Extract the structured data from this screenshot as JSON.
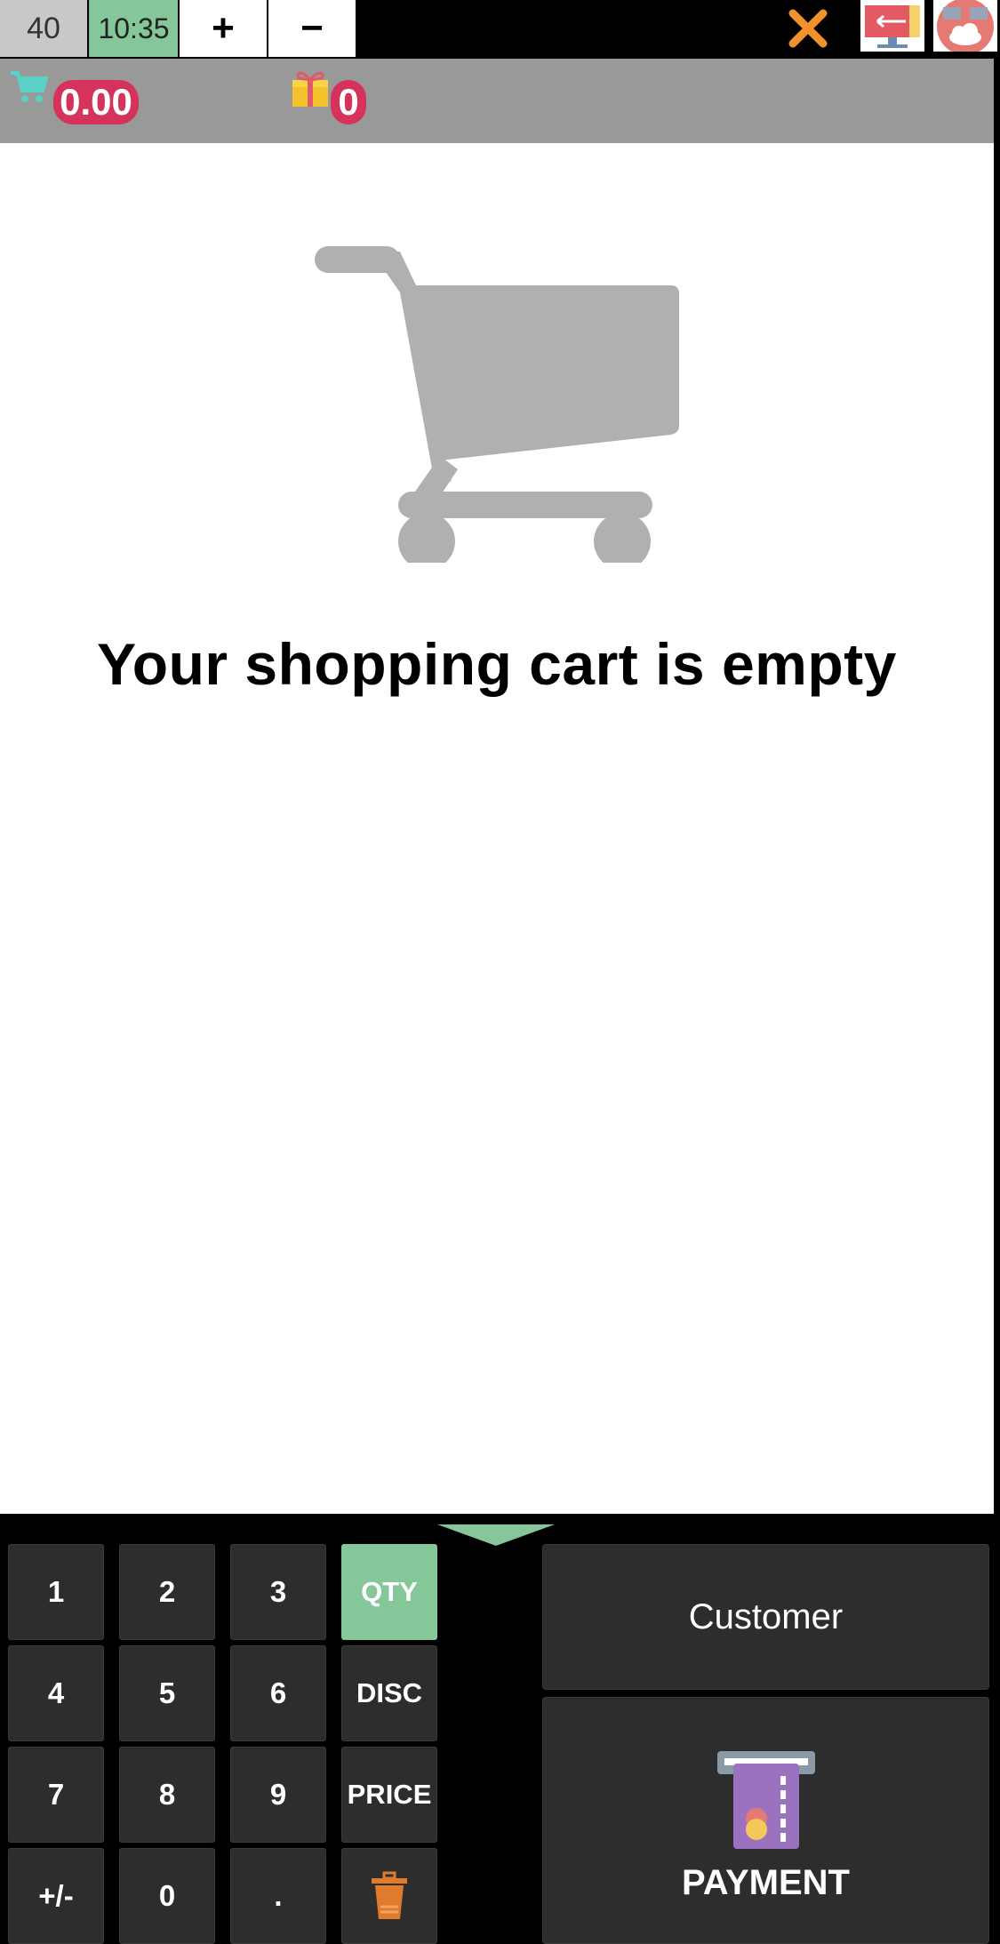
{
  "topbar": {
    "table_number": "40",
    "time": "10:35",
    "plus_label": "+",
    "minus_label": "−",
    "close_icon": "close-icon",
    "screen_icon": "swap-screen-icon",
    "cloud_icon": "cloud-sync-icon"
  },
  "summary": {
    "cart_total": "0.00",
    "gift_count": "0"
  },
  "main": {
    "empty_message": "Your shopping cart is empty",
    "empty_icon": "shopping-cart-icon"
  },
  "keypad": {
    "digits": {
      "k1": "1",
      "k2": "2",
      "k3": "3",
      "k4": "4",
      "k5": "5",
      "k6": "6",
      "k7": "7",
      "k8": "8",
      "k9": "9",
      "sign": "+/-",
      "k0": "0",
      "dot": "."
    },
    "modes": {
      "qty": "QTY",
      "disc": "DISC",
      "price": "PRICE",
      "delete_icon": "trash-icon"
    },
    "active_mode": "QTY"
  },
  "actions": {
    "customer_label": "Customer",
    "payment_label": "PAYMENT"
  },
  "colors": {
    "accent_green": "#86c79a",
    "badge_pink": "#d6335c",
    "close_orange": "#f0922e",
    "cart_gray": "#b0b0b0",
    "payment_purple": "#9b72c0"
  }
}
